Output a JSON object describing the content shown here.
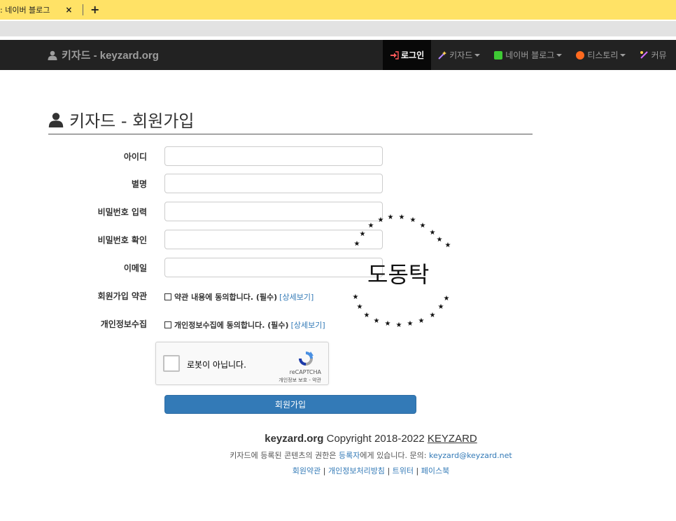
{
  "browser": {
    "tab_title": ": 네이버 블로그",
    "tab_close": "×",
    "new_tab": "+",
    "colors": {
      "tabstrip": "#ffe266"
    }
  },
  "navbar": {
    "brand_text": "키자드 - keyzard.org",
    "items": [
      {
        "label": "로그인",
        "icon": "login-icon",
        "active": true
      },
      {
        "label": "키자드",
        "icon": "magic-wand-icon"
      },
      {
        "label": "네이버 블로그",
        "icon": "naver-blog-icon"
      },
      {
        "label": "티스토리",
        "icon": "tistory-icon"
      },
      {
        "label": "커뮤",
        "icon": "community-icon"
      }
    ]
  },
  "page": {
    "title": "키자드 - 회원가입"
  },
  "form": {
    "labels": {
      "id": "아이디",
      "nickname": "별명",
      "password": "비밀번호 입력",
      "password_confirm": "비밀번호 확인",
      "email": "이메일",
      "terms": "회원가입 약관",
      "privacy": "개인정보수집"
    },
    "terms_check": "약관 내용에 동의합니다. (필수)",
    "privacy_check": "개인정보수집에 동의합니다. (필수)",
    "details_link": "[상세보기]",
    "submit": "회원가입"
  },
  "recaptcha": {
    "label": "로봇이 아닙니다.",
    "brand": "reCAPTCHA",
    "terms": "개인정보 보호 - 약관"
  },
  "watermark": {
    "text": "도동탁"
  },
  "footer": {
    "site": "keyzard.org",
    "copyright": "Copyright 2018-2022",
    "brand": "KEYZARD",
    "rights_prefix": "키자드에 등록된 콘텐츠의 권한은",
    "rights_link": "등록자",
    "rights_suffix": "에게 있습니다. 문의:",
    "contact_email": "keyzard@keyzard.net",
    "links": [
      "회원약관",
      "개인정보처리방침",
      "트위터",
      "페이스북"
    ],
    "link_sep": "|"
  }
}
